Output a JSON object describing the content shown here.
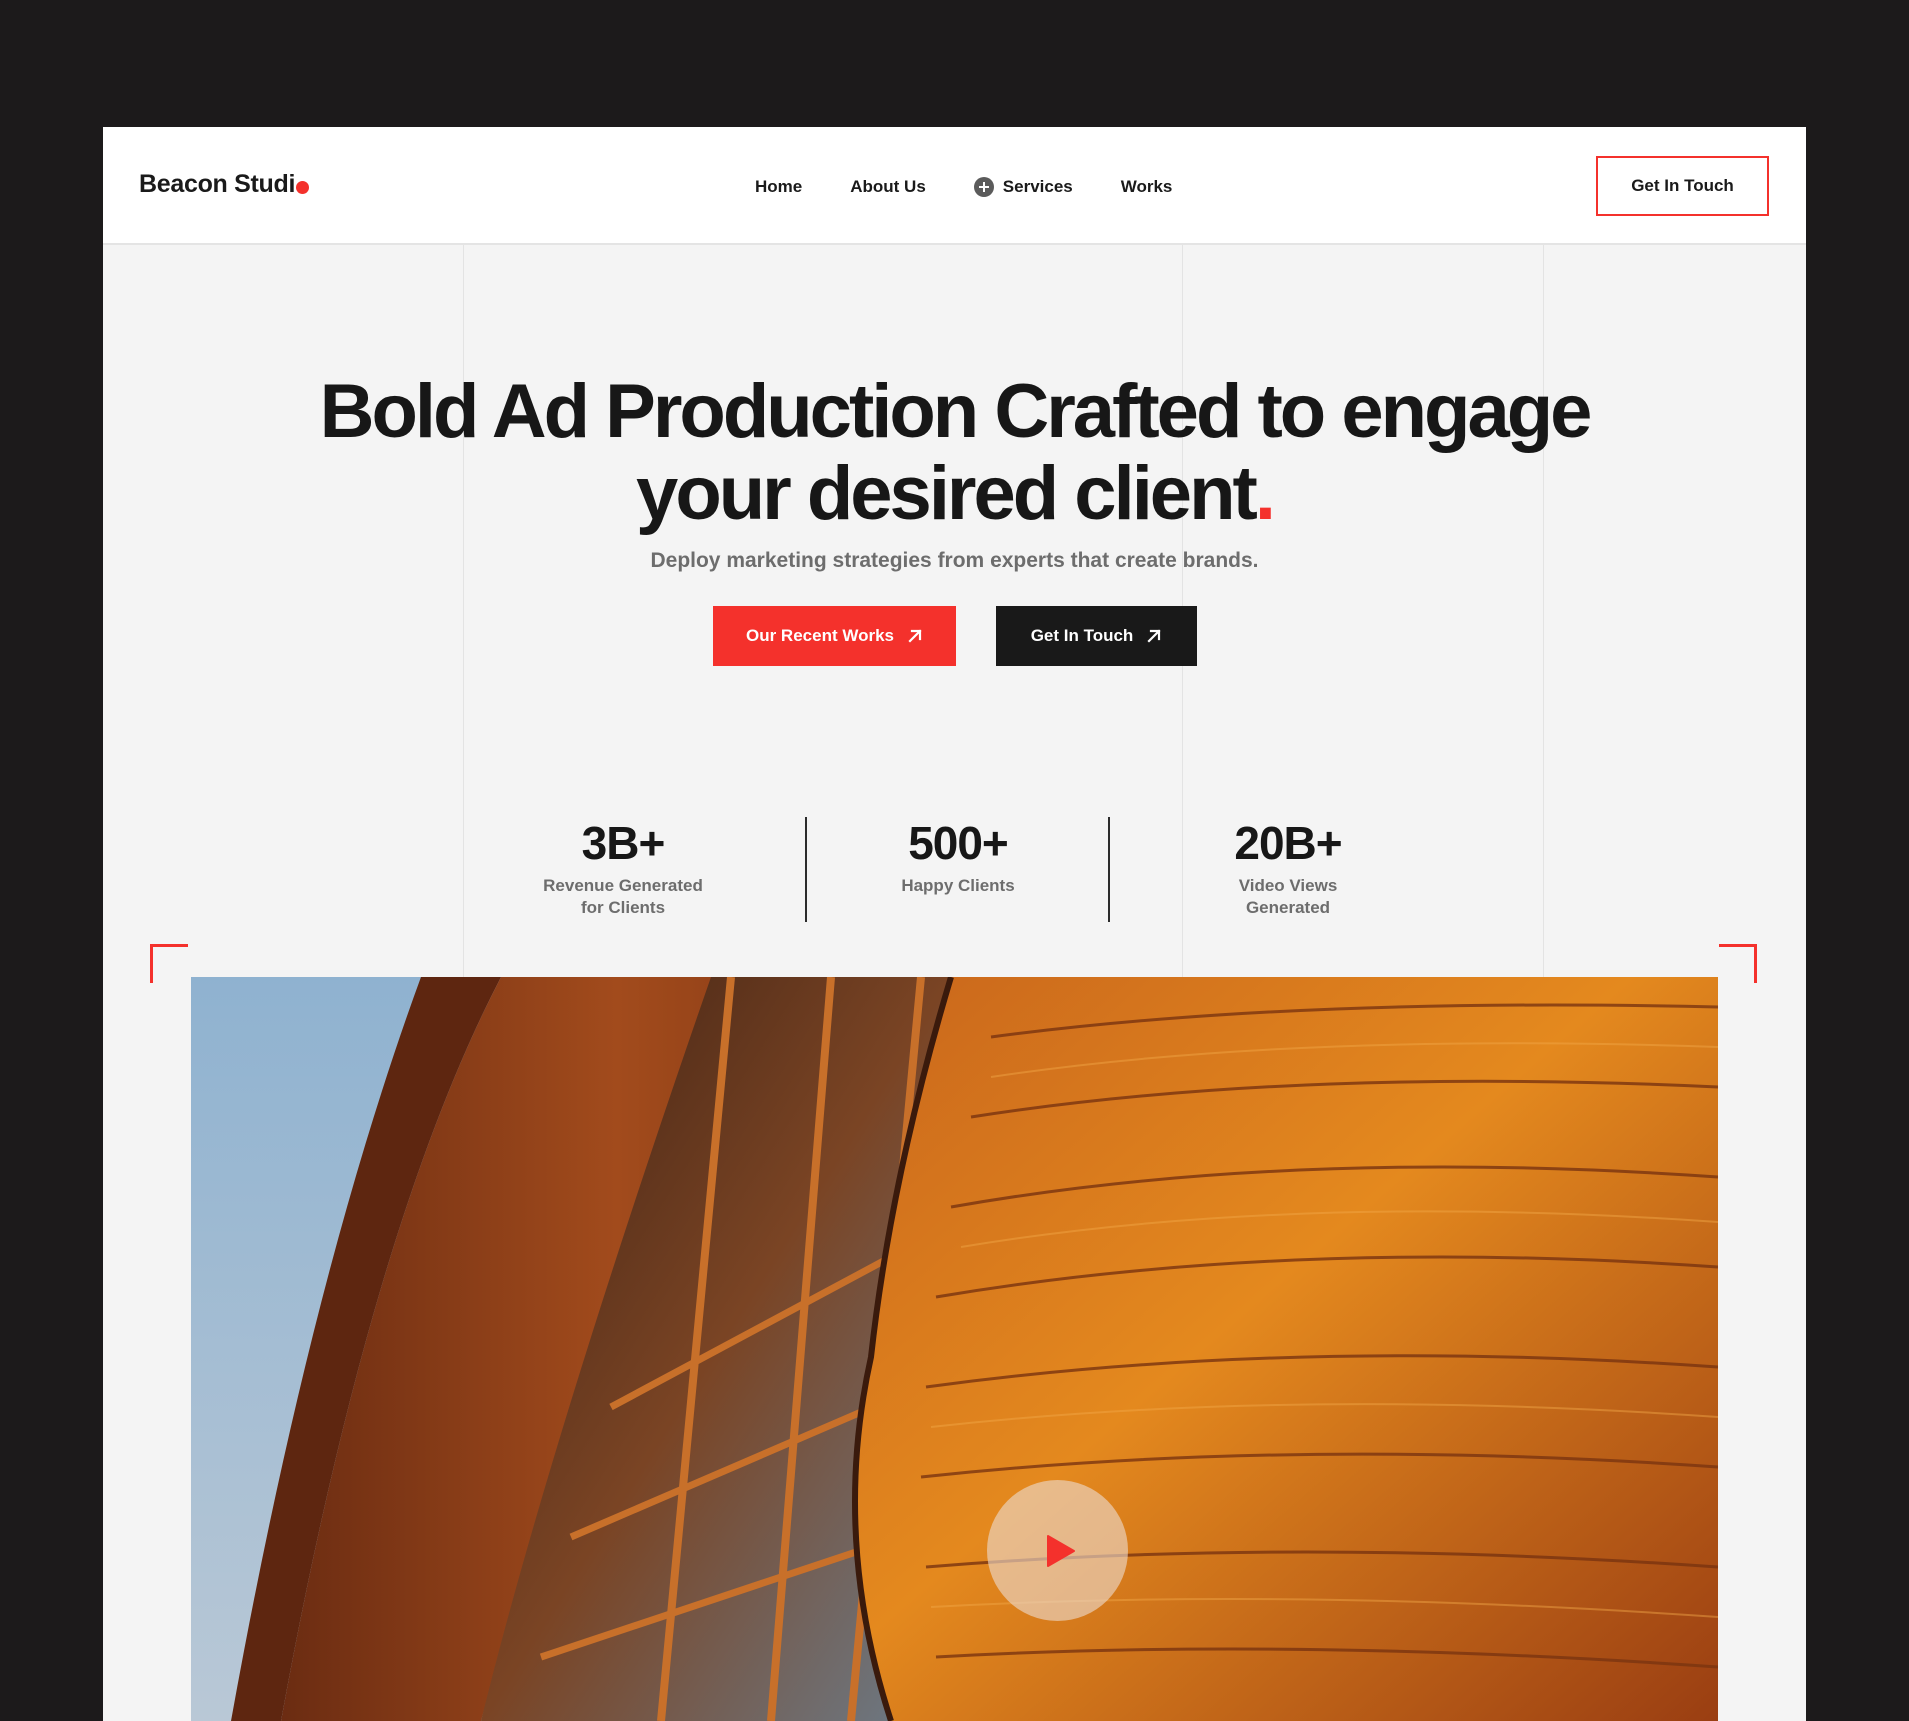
{
  "header": {
    "logo_text": "Beacon Studi",
    "logo_dot_color": "#f4312c",
    "nav": [
      {
        "label": "Home",
        "icon": null
      },
      {
        "label": "About Us",
        "icon": null
      },
      {
        "label": "Services",
        "icon": "plus-circle-icon"
      },
      {
        "label": "Works",
        "icon": null
      }
    ],
    "cta_label": "Get In Touch"
  },
  "hero": {
    "title_line1": "Bold Ad Production Crafted to engage",
    "title_line2": "your desired client",
    "title_dot": ".",
    "subtitle": "Deploy marketing strategies from experts that create brands.",
    "primary_button": {
      "label": "Our Recent Works",
      "icon": "arrow-up-right-icon"
    },
    "secondary_button": {
      "label": "Get In Touch",
      "icon": "arrow-up-right-icon"
    }
  },
  "stats": [
    {
      "value": "3B+",
      "label_line1": "Revenue Generated",
      "label_line2": "for Clients"
    },
    {
      "value": "500+",
      "label_line1": "Happy Clients",
      "label_line2": ""
    },
    {
      "value": "20B+",
      "label_line1": "Video Views",
      "label_line2": "Generated"
    }
  ],
  "video": {
    "image_description": "curved wooden building facade at sunset",
    "play_icon": "play-icon"
  },
  "colors": {
    "accent": "#f4312c",
    "dark": "#191919",
    "background": "#f4f4f4",
    "page_background": "#1c1a1b",
    "muted_text": "#6d6d6d"
  }
}
